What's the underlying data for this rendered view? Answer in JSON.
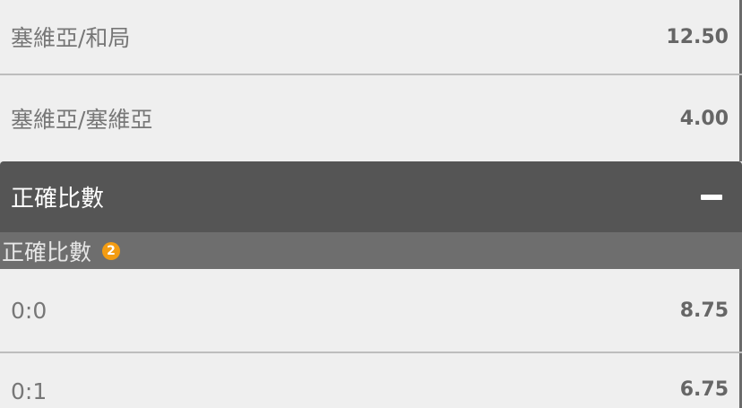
{
  "rows_top": [
    {
      "label": "塞維亞/和局",
      "odds": "12.50"
    },
    {
      "label": "塞維亞/塞維亞",
      "odds": "4.00"
    }
  ],
  "section": {
    "title": "正確比數"
  },
  "subsection": {
    "title": "正確比數",
    "badge": "2"
  },
  "rows_bottom": [
    {
      "label": "0:0",
      "odds": "8.75"
    },
    {
      "label": "0:1",
      "odds": "6.75"
    }
  ],
  "colors": {
    "badge": "#f39c12",
    "header_bg": "#555555",
    "subheader_bg": "#6e6e6e"
  }
}
